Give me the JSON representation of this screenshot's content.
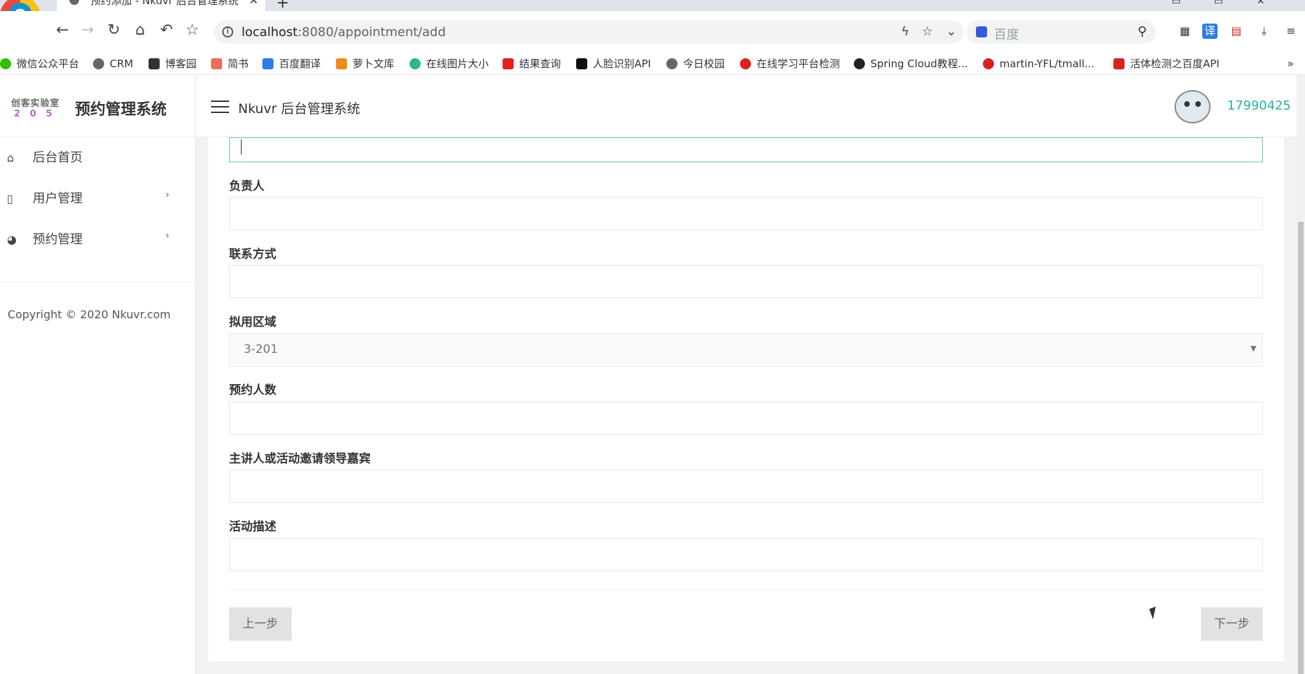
{
  "browser": {
    "tab_title": "预约添加 - Nkuvr 后台管理系统",
    "url_host": "localhost",
    "url_path": ":8080/appointment/add",
    "search_placeholder": "百度"
  },
  "bookmarks": [
    {
      "label": "微信公众平台",
      "color": "#2dc100"
    },
    {
      "label": "CRM",
      "color": "#666666"
    },
    {
      "label": "博客园",
      "color": "#333333"
    },
    {
      "label": "简书",
      "color": "#ea6f5a"
    },
    {
      "label": "百度翻译",
      "color": "#2e7ce6"
    },
    {
      "label": "萝卜文库",
      "color": "#f08b1b"
    },
    {
      "label": "在线图片大小",
      "color": "#2bb88a"
    },
    {
      "label": "结果查询",
      "color": "#e02020"
    },
    {
      "label": "人脸识别API",
      "color": "#111111"
    },
    {
      "label": "今日校园",
      "color": "#666666"
    },
    {
      "label": "在线学习平台检测",
      "color": "#d8231e"
    },
    {
      "label": "Spring Cloud教程...",
      "color": "#222222"
    },
    {
      "label": "martin-YFL/tmall...",
      "color": "#d8231e"
    },
    {
      "label": "活体检测之百度API",
      "color": "#d8231e"
    }
  ],
  "sidebar": {
    "logo_line1": "创客实验室",
    "logo_line2": "205",
    "title": "预约管理系统",
    "items": [
      {
        "label": "后台首页",
        "icon": "home-icon"
      },
      {
        "label": "用户管理",
        "icon": "file-icon",
        "arrow": "›"
      },
      {
        "label": "预约管理",
        "icon": "palette-icon",
        "arrow": "›"
      }
    ],
    "copyright": "Copyright © 2020 Nkuvr.com"
  },
  "header": {
    "title": "Nkuvr 后台管理系统",
    "username": "17990425"
  },
  "form": {
    "fields": [
      {
        "label": "负责人",
        "value": ""
      },
      {
        "label": "联系方式",
        "value": ""
      },
      {
        "label": "拟用区域",
        "value": "3-201",
        "type": "select"
      },
      {
        "label": "预约人数",
        "value": ""
      },
      {
        "label": "主讲人或活动邀请领导嘉宾",
        "value": ""
      },
      {
        "label": "活动描述",
        "value": ""
      }
    ],
    "prev_label": "上一步",
    "next_label": "下一步"
  },
  "colors": {
    "accent": "#2bb0a5",
    "focus_border": "#5fc9bd"
  }
}
